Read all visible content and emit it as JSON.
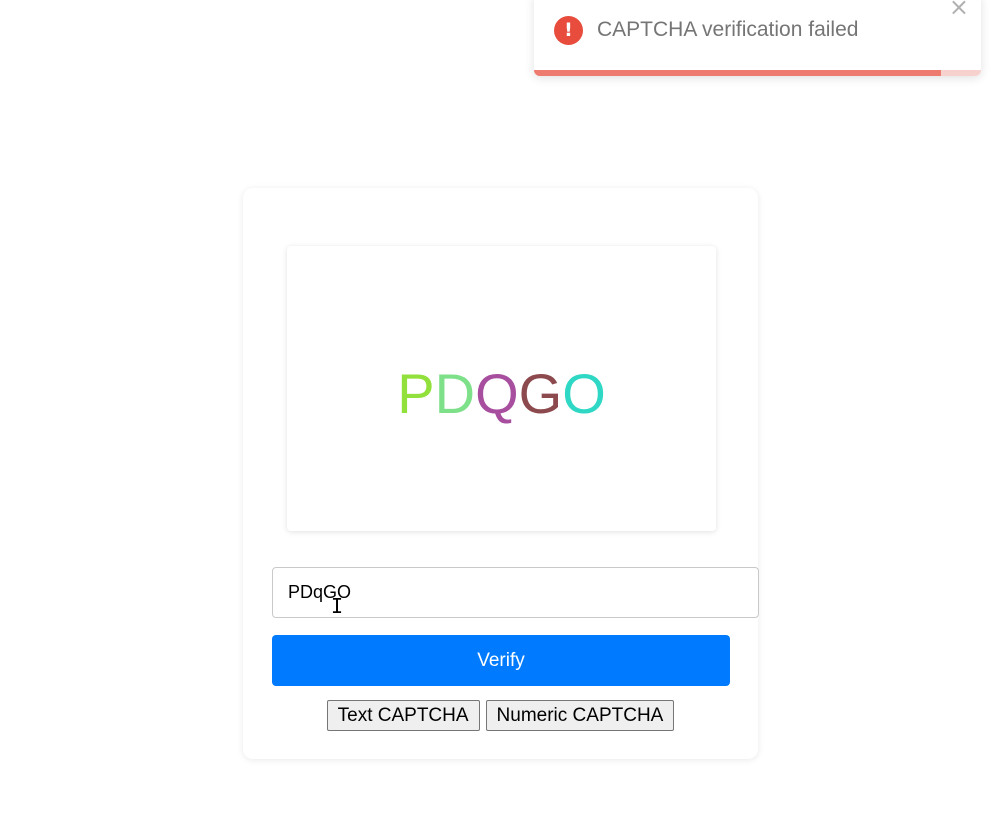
{
  "toast": {
    "message": "CAPTCHA verification failed",
    "icon": "alert-circle-icon",
    "close_symbol": "×",
    "status_color": "#e74c3c",
    "progress_percent": 91
  },
  "captcha": {
    "characters": [
      {
        "char": "P",
        "color": "#92e03b"
      },
      {
        "char": "D",
        "color": "#7fe08a"
      },
      {
        "char": "Q",
        "color": "#a74f9e"
      },
      {
        "char": "G",
        "color": "#8d4a4e"
      },
      {
        "char": "O",
        "color": "#2fd8c4"
      }
    ]
  },
  "form": {
    "input_value": "PDqGO",
    "verify_label": "Verify",
    "accent_color": "#007bff"
  },
  "mode_buttons": {
    "text_label": "Text CAPTCHA",
    "numeric_label": "Numeric CAPTCHA"
  },
  "cursor": {
    "glyph": "I"
  }
}
